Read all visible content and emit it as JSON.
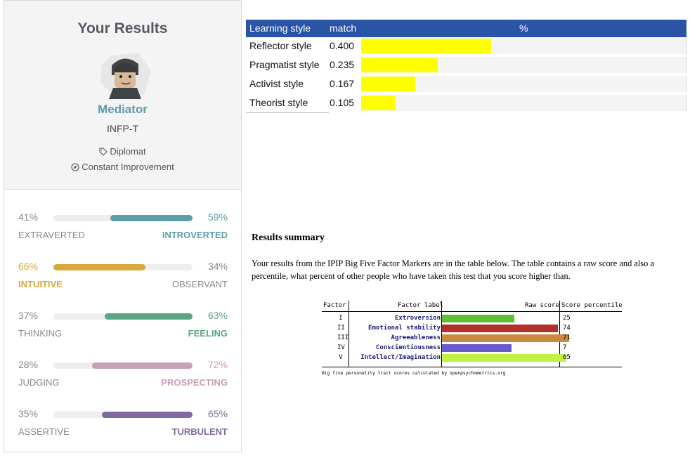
{
  "results_card": {
    "title": "Your Results",
    "type_name": "Mediator",
    "type_code": "INFP-T",
    "role": "Diplomat",
    "strategy": "Constant Improvement",
    "traits": [
      {
        "left_pct": "41%",
        "right_pct": "59%",
        "left_label": "EXTRAVERTED",
        "right_label": "INTROVERTED",
        "value": 59,
        "dominant": "right",
        "color": "#5b9fa9"
      },
      {
        "left_pct": "66%",
        "right_pct": "34%",
        "left_label": "INTUITIVE",
        "right_label": "OBSERVANT",
        "value": 66,
        "dominant": "left",
        "color": "#d9a93c"
      },
      {
        "left_pct": "37%",
        "right_pct": "63%",
        "left_label": "THINKING",
        "right_label": "FEELING",
        "value": 63,
        "dominant": "right",
        "color": "#5ba582"
      },
      {
        "left_pct": "28%",
        "right_pct": "72%",
        "left_label": "JUDGING",
        "right_label": "PROSPECTING",
        "value": 72,
        "dominant": "right",
        "color": "#c8a0b8"
      },
      {
        "left_pct": "35%",
        "right_pct": "65%",
        "left_label": "ASSERTIVE",
        "right_label": "TURBULENT",
        "value": 65,
        "dominant": "right",
        "color": "#7e6a9e"
      }
    ],
    "icons": {
      "role": "tag-icon",
      "strategy": "compass-icon",
      "avatar": "mediator-avatar-icon"
    }
  },
  "learning_style": {
    "headers": {
      "style": "Learning style",
      "match": "match",
      "percent": "%"
    },
    "rows": [
      {
        "style": "Reflector style",
        "match": "0.400"
      },
      {
        "style": "Pragmatist style",
        "match": "0.235"
      },
      {
        "style": "Activist style",
        "match": "0.167"
      },
      {
        "style": "Theorist style",
        "match": "0.105"
      }
    ],
    "header_color": "#2a54a6",
    "bar_color": "#ffff00"
  },
  "summary": {
    "title": "Results summary",
    "text": "Your results from the IPIP Big Five Factor Markers are in the table below. The table contains a raw score and also a percentile, what percent of other people who have taken this test that you score higher than."
  },
  "big_five": {
    "headers": {
      "factor": "Factor",
      "label": "Factor label",
      "raw": "Raw score",
      "percentile": "Score percentile"
    },
    "rows": [
      {
        "factor": "I",
        "label": "Extroversion",
        "percentile": "25",
        "raw_score": 25,
        "color": "#5cbf36"
      },
      {
        "factor": "II",
        "label": "Emotional stability",
        "percentile": "74",
        "raw_score": 40,
        "color": "#b0312a"
      },
      {
        "factor": "III",
        "label": "Agreeableness",
        "percentile": "71",
        "raw_score": 44,
        "color": "#c98a40"
      },
      {
        "factor": "IV",
        "label": "Conscientiousness",
        "percentile": "7",
        "raw_score": 24,
        "color": "#6a5acd"
      },
      {
        "factor": "V",
        "label": "Intellect/Imagination",
        "percentile": "65",
        "raw_score": 43,
        "color": "#bff242"
      }
    ],
    "caption": "Big five personality trait scores calculated by openpsychometrics.org"
  }
}
